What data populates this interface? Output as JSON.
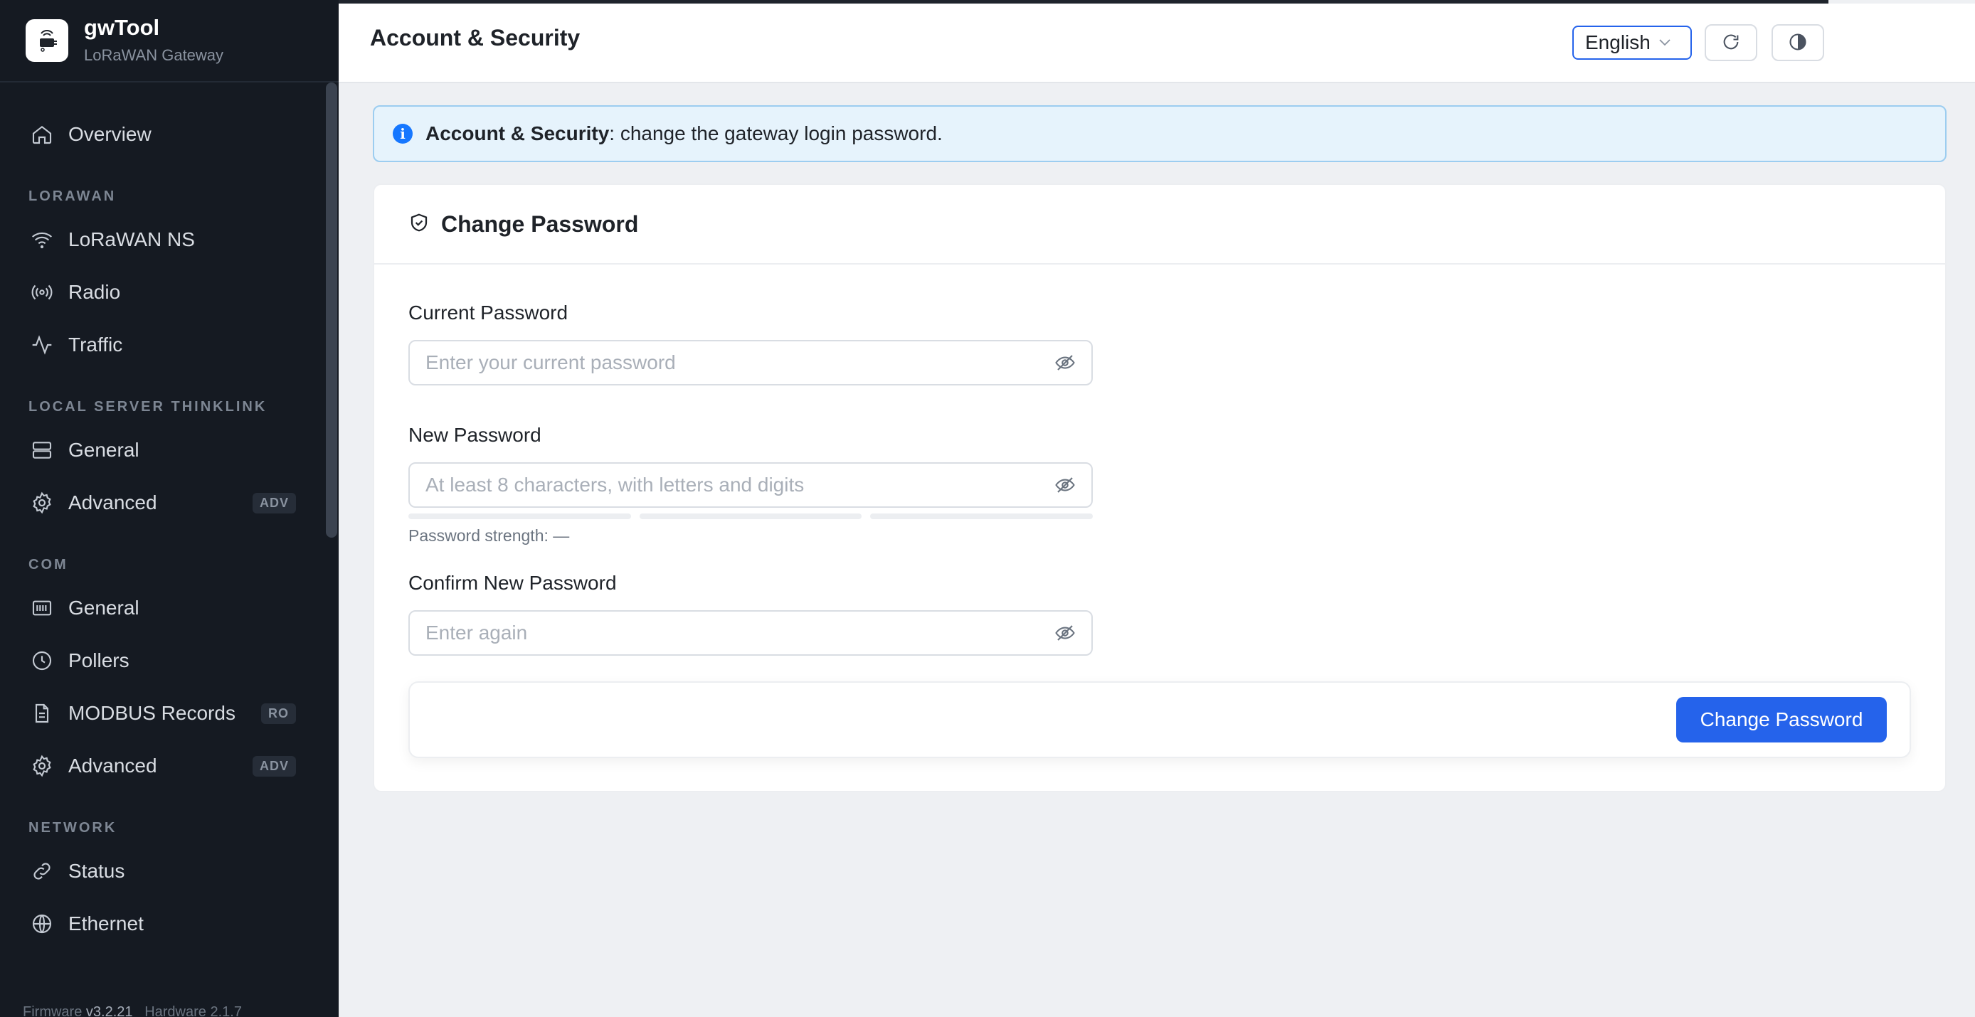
{
  "app": {
    "name": "gwTool",
    "subtitle": "LoRaWAN Gateway"
  },
  "sidebar": {
    "overview": {
      "label": "Overview",
      "icon": "home-icon"
    },
    "sections": [
      {
        "title": "LORAWAN",
        "items": [
          {
            "label": "LoRaWAN NS",
            "icon": "wifi-icon",
            "badge": ""
          },
          {
            "label": "Radio",
            "icon": "radio-icon",
            "badge": ""
          },
          {
            "label": "Traffic",
            "icon": "activity-icon",
            "badge": ""
          }
        ]
      },
      {
        "title": "LOCAL SERVER THINKLINK",
        "items": [
          {
            "label": "General",
            "icon": "server-icon",
            "badge": ""
          },
          {
            "label": "Advanced",
            "icon": "gear-icon",
            "badge": "ADV"
          }
        ]
      },
      {
        "title": "COM",
        "items": [
          {
            "label": "General",
            "icon": "serial-port-icon",
            "badge": ""
          },
          {
            "label": "Pollers",
            "icon": "clock-icon",
            "badge": ""
          },
          {
            "label": "MODBUS Records",
            "icon": "document-icon",
            "badge": "RO"
          },
          {
            "label": "Advanced",
            "icon": "gear-icon",
            "badge": "ADV"
          }
        ]
      },
      {
        "title": "NETWORK",
        "items": [
          {
            "label": "Status",
            "icon": "link-icon",
            "badge": ""
          },
          {
            "label": "Ethernet",
            "icon": "globe-icon",
            "badge": ""
          }
        ]
      }
    ],
    "footer": {
      "firmware_label": "Firmware",
      "firmware_version": "v3.2.21",
      "hardware_label": "Hardware",
      "hardware_version": "2.1.7"
    }
  },
  "header": {
    "title": "Account & Security",
    "language": "English",
    "refresh_icon": "refresh-icon",
    "theme_icon": "theme-toggle-icon"
  },
  "alert": {
    "bold": "Account & Security",
    "text": ": change the gateway login password."
  },
  "card": {
    "title": "Change Password",
    "icon": "shield-check-icon",
    "fields": {
      "current": {
        "label": "Current Password",
        "placeholder": "Enter your current password",
        "value": ""
      },
      "new": {
        "label": "New Password",
        "placeholder": "At least 8 characters, with letters and digits",
        "value": ""
      },
      "confirm": {
        "label": "Confirm New Password",
        "placeholder": "Enter again",
        "value": ""
      }
    },
    "strength_text": "Password strength: —",
    "submit_label": "Change Password"
  },
  "colors": {
    "accent": "#2563eb",
    "sidebar_bg": "#151a22",
    "info": "#1677ff",
    "info_bg": "#e6f3fc"
  }
}
